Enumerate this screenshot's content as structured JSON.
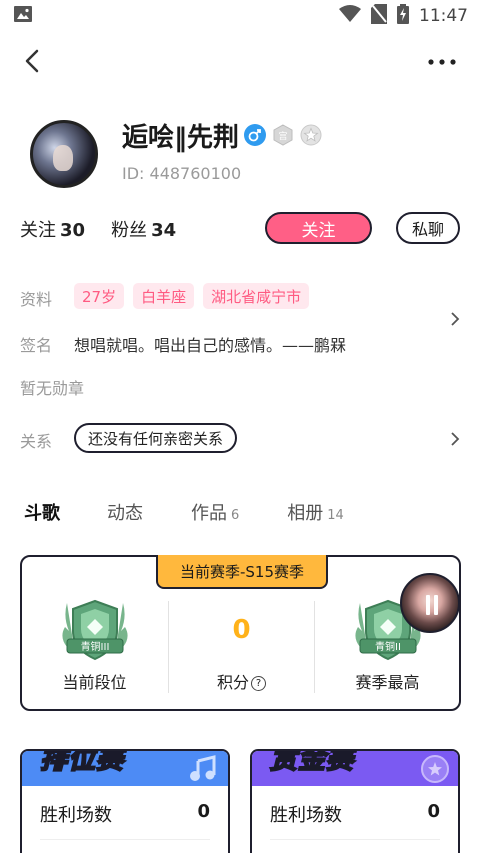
{
  "status_bar": {
    "time": "11:47"
  },
  "profile": {
    "username": "逅哙‖先荆",
    "id_text": "ID: 448760100",
    "gender_icon": "male-icon",
    "colors": {
      "accent": "#ff5f86",
      "gold": "#ffb21a",
      "male_blue": "#2f9bef"
    }
  },
  "stats": {
    "following_label": "关注",
    "following_count": "30",
    "fans_label": "粉丝",
    "fans_count": "34"
  },
  "actions": {
    "follow_label": "关注",
    "chat_label": "私聊"
  },
  "info": {
    "profile_label": "资料",
    "tags": [
      "27岁",
      "白羊座",
      "湖北省咸宁市"
    ],
    "signature_label": "签名",
    "signature": "想唱就唱。唱出自己的感情。——鹏槑",
    "medal_text": "暂无勋章",
    "relation_label": "关系",
    "relation_value": "还没有任何亲密关系"
  },
  "tabs": [
    {
      "label": "斗歌",
      "count": ""
    },
    {
      "label": "动态",
      "count": ""
    },
    {
      "label": "作品",
      "count": "6"
    },
    {
      "label": "相册",
      "count": "14"
    }
  ],
  "season": {
    "tag": "当前赛季-S15赛季",
    "current_rank_label": "当前段位",
    "current_rank_badge": "青铜III",
    "points_value": "0",
    "points_label": "积分",
    "season_best_label": "赛季最高",
    "season_best_badge": "青铜II"
  },
  "matches": [
    {
      "title": "排位赛",
      "stat_label": "胜利场数",
      "stat_value": "0",
      "color": "#4d8bf5"
    },
    {
      "title": "赏金赛",
      "stat_label": "胜利场数",
      "stat_value": "0",
      "color": "#7b5af2"
    }
  ]
}
